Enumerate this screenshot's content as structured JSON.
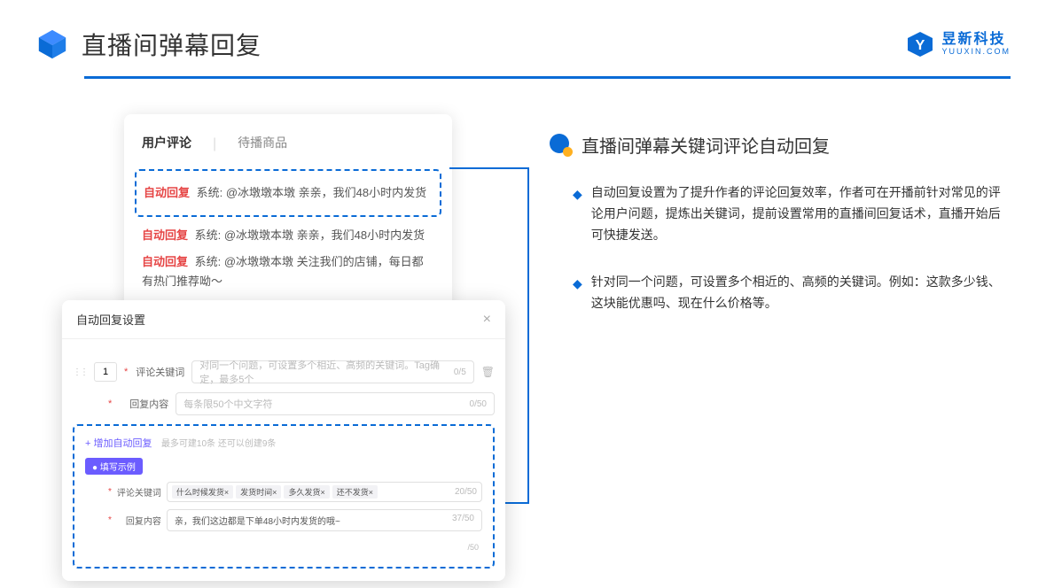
{
  "header": {
    "title": "直播间弹幕回复",
    "brand_cn": "昱新科技",
    "brand_en": "YUUXIN.COM"
  },
  "comment_panel": {
    "tab_active": "用户评论",
    "tab_inactive": "待播商品",
    "rows": [
      {
        "badge": "自动回复",
        "text": "系统: @冰墩墩本墩 亲亲，我们48小时内发货"
      },
      {
        "badge": "自动回复",
        "text": "系统: @冰墩墩本墩 亲亲，我们48小时内发货"
      },
      {
        "badge": "自动回复",
        "text": "系统: @冰墩墩本墩 关注我们的店铺，每日都有热门推荐呦～"
      }
    ]
  },
  "settings": {
    "title": "自动回复设置",
    "index_value": "1",
    "keyword_label": "评论关键词",
    "keyword_placeholder": "对同一个问题，可设置多个相近、高频的关键词。Tag确定，最多5个",
    "keyword_counter": "0/5",
    "content_label": "回复内容",
    "content_placeholder": "每条限50个中文字符",
    "content_counter": "0/50",
    "add_link": "+ 增加自动回复",
    "add_hint": "最多可建10条 还可以创建9条",
    "example_badge": "● 填写示例",
    "example_keyword_label": "评论关键词",
    "example_tags": [
      "什么时候发货×",
      "发货时间×",
      "多久发货×",
      "还不发货×"
    ],
    "example_keyword_counter": "20/50",
    "example_content_label": "回复内容",
    "example_content_value": "亲，我们这边都是下单48小时内发货的哦~",
    "example_content_counter": "37/50",
    "spare_counter": "/50"
  },
  "right": {
    "section_title": "直播间弹幕关键词评论自动回复",
    "bullets": [
      "自动回复设置为了提升作者的评论回复效率，作者可在开播前针对常见的评论用户问题，提炼出关键词，提前设置常用的直播间回复话术，直播开始后可快捷发送。",
      "针对同一个问题，可设置多个相近的、高频的关键词。例如：这款多少钱、这块能优惠吗、现在什么价格等。"
    ]
  }
}
